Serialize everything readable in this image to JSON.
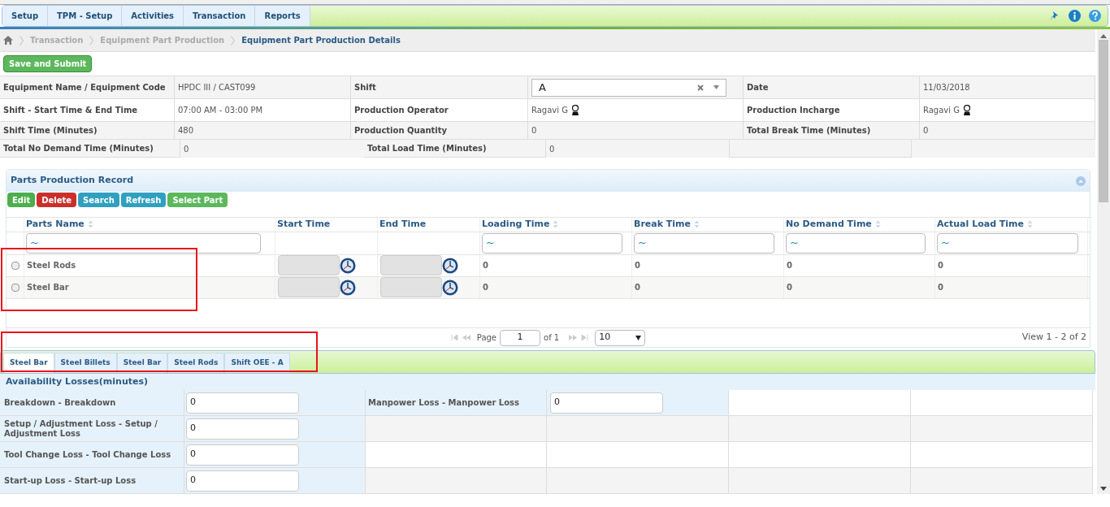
{
  "menu": [
    {
      "label": "Setup"
    },
    {
      "label": "TPM - Setup"
    },
    {
      "label": "Activities"
    },
    {
      "label": "Transaction"
    },
    {
      "label": "Reports"
    }
  ],
  "breadcrumb": [
    "Transaction",
    "Equipment Part Production",
    "Equipment Part Production Details"
  ],
  "save_button": "Save and Submit",
  "details": [
    [
      {
        "label": "Equipment Name / Equipment Code",
        "value": "HPDC III / CAST099",
        "kind": "text"
      },
      {
        "label": "Shift",
        "value": "A",
        "kind": "select"
      },
      {
        "label": "Date",
        "value": "11/03/2018",
        "kind": "text"
      }
    ],
    [
      {
        "label": "Shift - Start Time & End Time",
        "value": "07:00 AM - 03:00 PM",
        "kind": "text"
      },
      {
        "label": "Production Operator",
        "value": "Ragavi G",
        "kind": "person"
      },
      {
        "label": "Production Incharge",
        "value": "Ragavi G",
        "kind": "person"
      }
    ],
    [
      {
        "label": "Shift Time (Minutes)",
        "value": "480",
        "kind": "text"
      },
      {
        "label": "Production Quantity",
        "value": "0",
        "kind": "text"
      },
      {
        "label": "Total Break Time (Minutes)",
        "value": "0",
        "kind": "text"
      }
    ],
    [
      {
        "label": "Total No Demand Time (Minutes)",
        "value": "0",
        "kind": "text"
      },
      {
        "label": "Total Load Time (Minutes)",
        "value": "0",
        "kind": "text"
      }
    ]
  ],
  "parts_panel": {
    "title": "Parts Production Record",
    "buttons": [
      {
        "label": "Edit",
        "color": "#4cae4c"
      },
      {
        "label": "Delete",
        "color": "#c9302c"
      },
      {
        "label": "Search",
        "color": "#31a0c0"
      },
      {
        "label": "Refresh",
        "color": "#31a0c0"
      },
      {
        "label": "Select Part",
        "color": "#5cb85c"
      }
    ],
    "columns": [
      {
        "label": "Parts Name",
        "kind": "text",
        "sortable": true,
        "filter": "~"
      },
      {
        "label": "Start Time",
        "kind": "time",
        "sortable": false
      },
      {
        "label": "End Time",
        "kind": "time",
        "sortable": false
      },
      {
        "label": "Loading Time",
        "kind": "number",
        "sortable": true,
        "filter": "~"
      },
      {
        "label": "Break Time",
        "kind": "number",
        "sortable": true,
        "filter": "~"
      },
      {
        "label": "No Demand Time",
        "kind": "number",
        "sortable": true,
        "filter": "~"
      },
      {
        "label": "Actual Load Time",
        "kind": "number",
        "sortable": true,
        "filter": "~"
      }
    ],
    "rows": [
      {
        "name": "Steel Rods",
        "checked": false,
        "values": [
          "0",
          "0",
          "0",
          "0"
        ]
      },
      {
        "name": "Steel Bar",
        "checked": false,
        "values": [
          "0",
          "0",
          "0",
          "0"
        ]
      }
    ],
    "pager": {
      "page_label": "Page",
      "page": "1",
      "of": "of 1",
      "page_size": "10",
      "view": "View 1 - 2 of 2"
    }
  },
  "tabs": [
    {
      "label": "Steel Bar",
      "selected": true
    },
    {
      "label": "Steel Billets",
      "selected": false
    },
    {
      "label": "Steel Bar",
      "selected": false
    },
    {
      "label": "Steel Rods",
      "selected": false
    },
    {
      "label": "Shift OEE - A",
      "selected": false
    }
  ],
  "losses": {
    "title": "Availability Losses(minutes)",
    "left": [
      {
        "label": "Breakdown - Breakdown",
        "value": "0"
      },
      {
        "label": "Setup / Adjustment Loss - Setup / Adjustment Loss",
        "value": "0"
      },
      {
        "label": "Tool Change Loss - Tool Change Loss",
        "value": "0"
      },
      {
        "label": "Start-up Loss - Start-up Loss",
        "value": "0"
      }
    ],
    "right": [
      {
        "label": "Manpower Loss - Manpower Loss",
        "value": "0"
      }
    ]
  }
}
